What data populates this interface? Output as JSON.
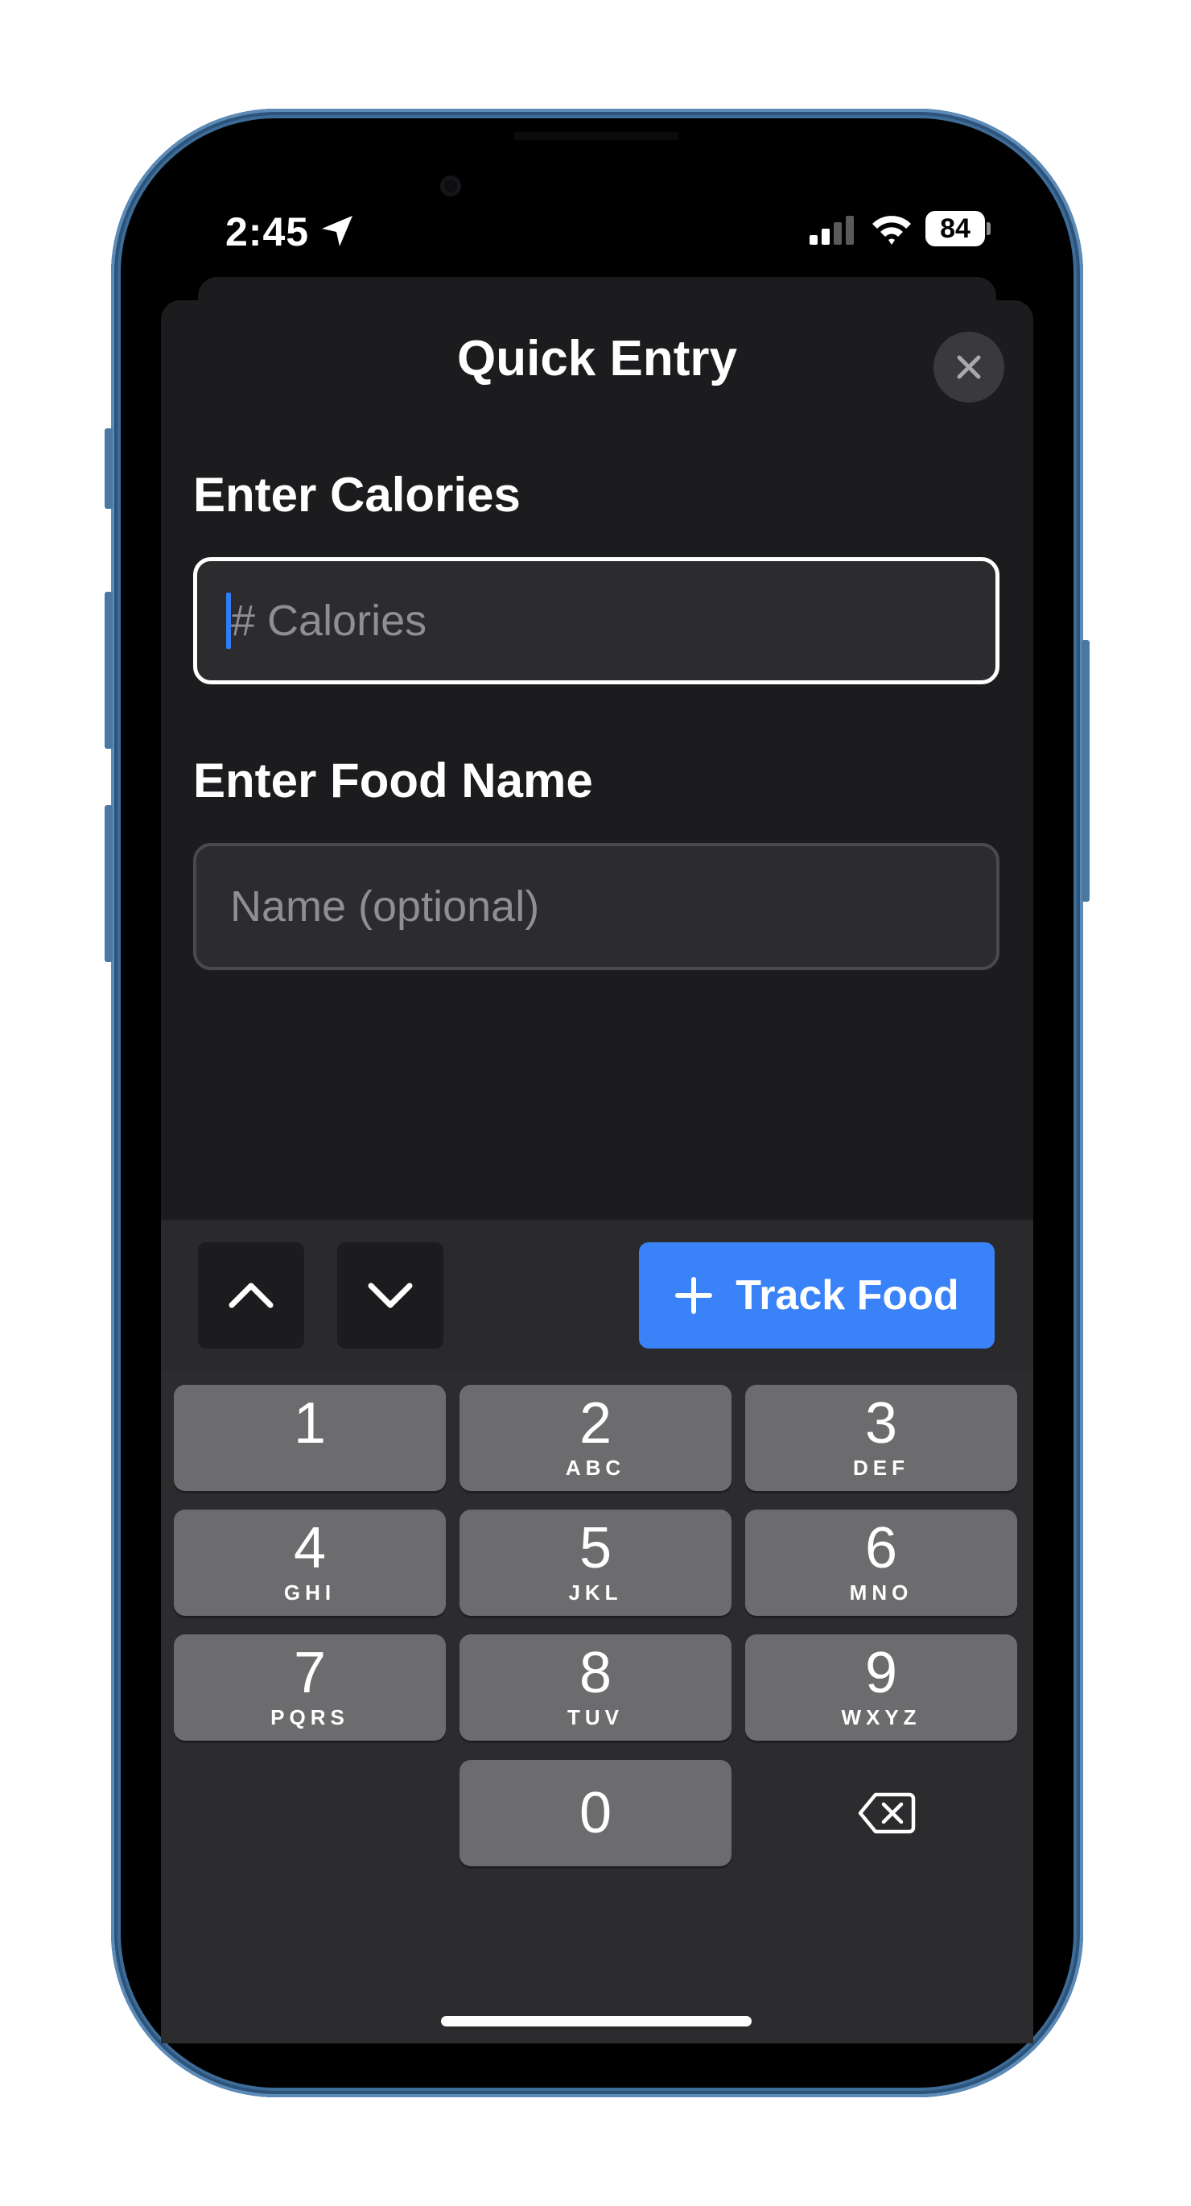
{
  "status_bar": {
    "time": "2:45",
    "location_icon": "location-arrow-icon",
    "signal_icon": "cellular-signal-icon",
    "wifi_icon": "wifi-icon",
    "battery_level": "84"
  },
  "sheet": {
    "title": "Quick Entry",
    "close_icon": "close-icon",
    "calories": {
      "label": "Enter Calories",
      "placeholder": "# Calories",
      "value": ""
    },
    "food_name": {
      "label": "Enter Food Name",
      "placeholder": "Name (optional)",
      "value": ""
    }
  },
  "accessory_bar": {
    "prev_icon": "chevron-up-icon",
    "next_icon": "chevron-down-icon",
    "track_button_label": "Track Food",
    "track_button_icon": "plus-icon"
  },
  "keypad": {
    "keys": [
      {
        "digit": "1",
        "letters": ""
      },
      {
        "digit": "2",
        "letters": "ABC"
      },
      {
        "digit": "3",
        "letters": "DEF"
      },
      {
        "digit": "4",
        "letters": "GHI"
      },
      {
        "digit": "5",
        "letters": "JKL"
      },
      {
        "digit": "6",
        "letters": "MNO"
      },
      {
        "digit": "7",
        "letters": "PQRS"
      },
      {
        "digit": "8",
        "letters": "TUV"
      },
      {
        "digit": "9",
        "letters": "WXYZ"
      },
      {
        "digit": "0",
        "letters": ""
      }
    ],
    "delete_icon": "backspace-icon"
  },
  "colors": {
    "accent": "#3a82f7",
    "sheet_background": "#1c1c1e",
    "key_background": "#6c6c6e",
    "phone_frame": "#3e6c98"
  }
}
